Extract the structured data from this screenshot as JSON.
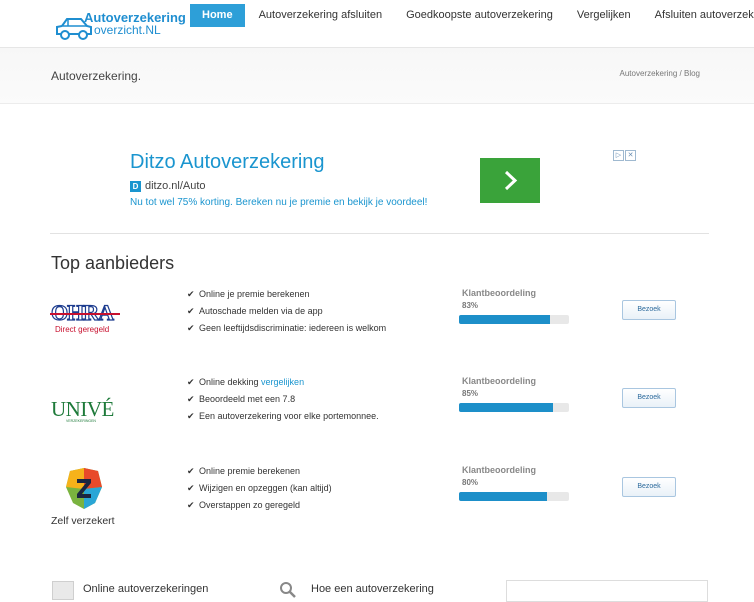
{
  "logo": {
    "line1": "Autoverzekering",
    "line2": "overzicht.NL"
  },
  "nav": {
    "items": [
      "Home",
      "Autoverzekering afsluiten",
      "Goedkoopste autoverzekering",
      "Vergelijken",
      "Afsluiten autoverzekering"
    ],
    "active_index": 0
  },
  "page": {
    "title": "Autoverzekering.",
    "breadcrumb": "Autoverzekering  /  Blog"
  },
  "ad": {
    "headline": "Ditzo Autoverzekering",
    "favicon_letter": "D",
    "url": "ditzo.nl/Auto",
    "description": "Nu tot wel 75% korting. Bereken nu je premie en bekijk je voordeel!",
    "button_color": "#3aa33a",
    "arrow": "›",
    "choices_icons": [
      "▷",
      "✕"
    ]
  },
  "section": {
    "title": "Top aanbieders"
  },
  "providers": [
    {
      "name": "OHRA",
      "tagline": "Direct geregeld",
      "features": [
        {
          "text": "Online je premie berekenen"
        },
        {
          "text": "Autoschade melden via de app"
        },
        {
          "text": "Geen leeftijdsdiscriminatie: iedereen is welkom"
        }
      ],
      "rating_label": "Klantbeoordeling",
      "rating_percent": "83%",
      "rating_value": 0.83,
      "button": "Bezoek"
    },
    {
      "name": "UNIVÉ",
      "tagline": "VERZEKERINGEN",
      "features": [
        {
          "text": "Online dekking ",
          "link": "vergelijken"
        },
        {
          "text": "Beoordeeld met een 7.8"
        },
        {
          "text": "Een autoverzekering voor elke portemonnee."
        }
      ],
      "rating_label": "Klantbeoordeling",
      "rating_percent": "85%",
      "rating_value": 0.85,
      "button": "Bezoek"
    },
    {
      "name": "Zelf verzekert",
      "tagline": "Z",
      "features": [
        {
          "text": "Online premie berekenen"
        },
        {
          "text": "Wijzigen en opzeggen (kan altijd)"
        },
        {
          "text": "Overstappen zo geregeld"
        }
      ],
      "rating_label": "Klantbeoordeling",
      "rating_percent": "80%",
      "rating_value": 0.8,
      "button": "Bezoek"
    }
  ],
  "footer": {
    "online_label": "Online autoverzekeringen",
    "howto_label": "Hoe een autoverzekering"
  },
  "colors": {
    "accent": "#2d9fd8",
    "link": "#1a95cf",
    "bar": "#1d8fc9"
  },
  "icons": {
    "check": "✔"
  }
}
